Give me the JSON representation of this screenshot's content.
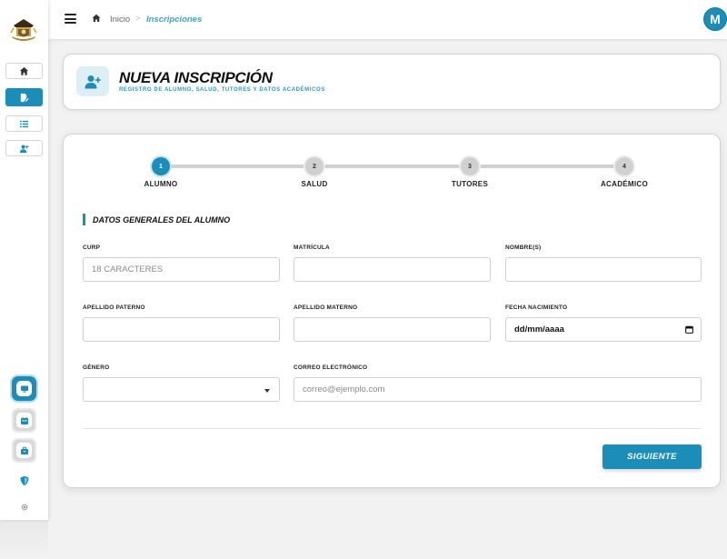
{
  "colors": {
    "accent": "#1b8db8",
    "accent_light": "#ddeef5",
    "subtitle": "#2d9cc6"
  },
  "topbar": {
    "breadcrumb_home": "Inicio",
    "breadcrumb_separator": ">",
    "breadcrumb_current": "Inscripciones",
    "avatar_initial": "M"
  },
  "sidebar": {
    "items": [
      {
        "icon": "home-icon"
      },
      {
        "icon": "file-edit-icon",
        "active": true
      },
      {
        "icon": "list-icon"
      },
      {
        "icon": "user-plus-icon"
      }
    ],
    "bottom": [
      {
        "icon": "monitor-icon"
      },
      {
        "icon": "calendar-icon"
      },
      {
        "icon": "briefcase-icon"
      },
      {
        "icon": "shield-icon"
      },
      {
        "icon": "gear-icon"
      }
    ]
  },
  "header": {
    "title": "NUEVA INSCRIPCIÓN",
    "subtitle": "REGISTRO DE ALUMNO, SALUD, TUTORES Y DATOS ACADÉMICOS",
    "icon": "user-plus-icon"
  },
  "steps": [
    {
      "number": "1",
      "label": "ALUMNO",
      "active": true
    },
    {
      "number": "2",
      "label": "SALUD",
      "active": false
    },
    {
      "number": "3",
      "label": "TUTORES",
      "active": false
    },
    {
      "number": "4",
      "label": "ACADÉMICO",
      "active": false
    }
  ],
  "section_title": "DATOS GENERALES DEL ALUMNO",
  "form": {
    "curp": {
      "label": "CURP",
      "placeholder": "18 CARACTERES",
      "value": ""
    },
    "matricula": {
      "label": "MATRÍCULA",
      "value": ""
    },
    "nombres": {
      "label": "NOMBRE(S)",
      "value": ""
    },
    "apellido_paterno": {
      "label": "APELLIDO PATERNO",
      "value": ""
    },
    "apellido_materno": {
      "label": "APELLIDO MATERNO",
      "value": ""
    },
    "fecha_nacimiento": {
      "label": "FECHA NACIMIENTO",
      "placeholder": "dd/mm/aaaa"
    },
    "genero": {
      "label": "GÉNERO",
      "value": ""
    },
    "correo": {
      "label": "CORREO ELECTRÓNICO",
      "placeholder": "correo@ejemplo.com",
      "value": ""
    }
  },
  "next_button": "SIGUIENTE"
}
